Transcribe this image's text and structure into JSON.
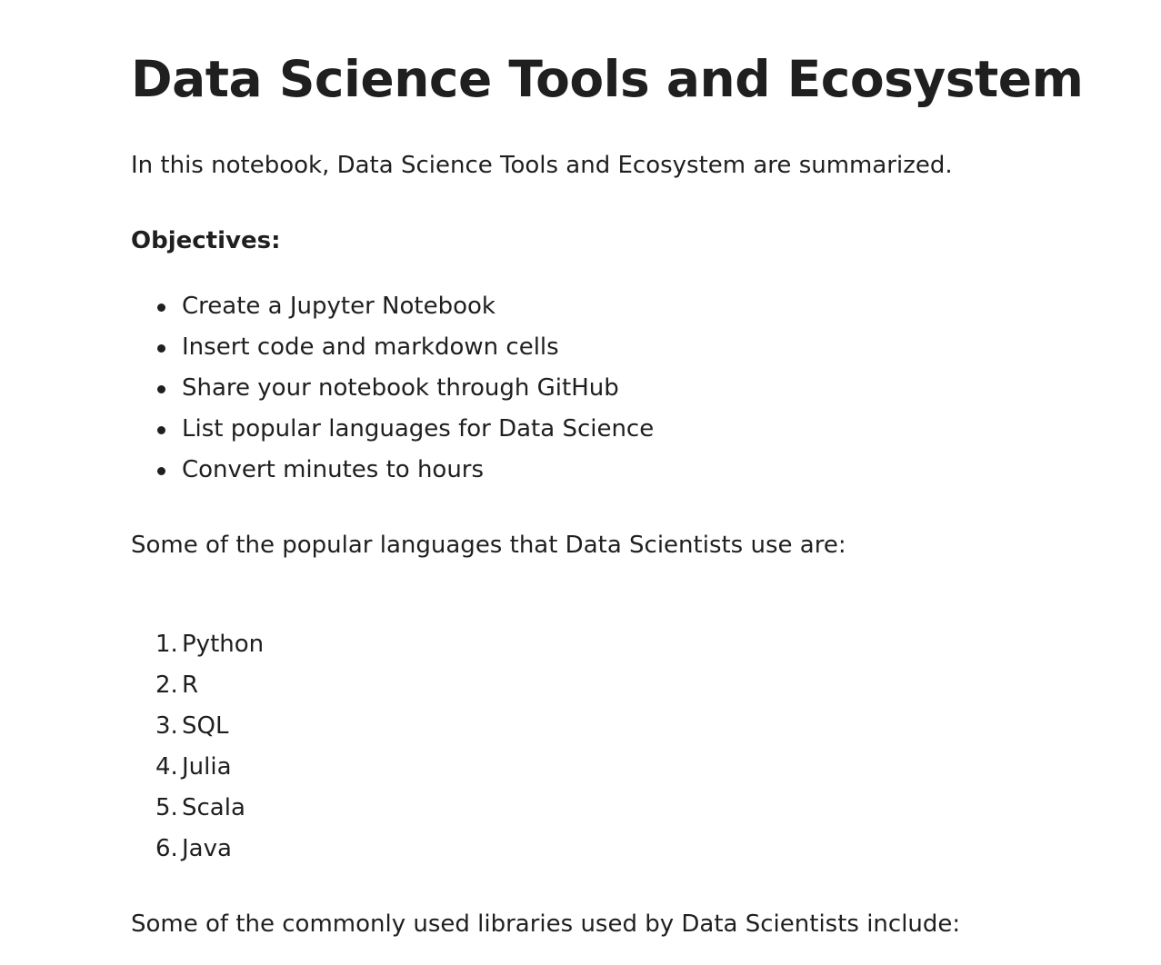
{
  "notebook": {
    "title": "Data Science Tools and Ecosystem",
    "intro": "In this notebook, Data Science Tools and Ecosystem are summarized.",
    "objectives_heading": "Objectives:",
    "objectives": [
      "Create a Jupyter Notebook",
      "Insert code and markdown cells",
      "Share your notebook through GitHub",
      "List popular languages for Data Science",
      "Convert minutes to hours"
    ],
    "languages_intro": "Some of the popular languages that Data Scientists use are:",
    "languages": [
      {
        "number": "1.",
        "name": "Python"
      },
      {
        "number": "2.",
        "name": "R"
      },
      {
        "number": "3.",
        "name": "SQL"
      },
      {
        "number": "4.",
        "name": "Julia"
      },
      {
        "number": "5.",
        "name": "Scala"
      },
      {
        "number": "6.",
        "name": "Java"
      }
    ],
    "libraries_intro": "Some of the commonly used libraries used by Data Scientists include:"
  }
}
